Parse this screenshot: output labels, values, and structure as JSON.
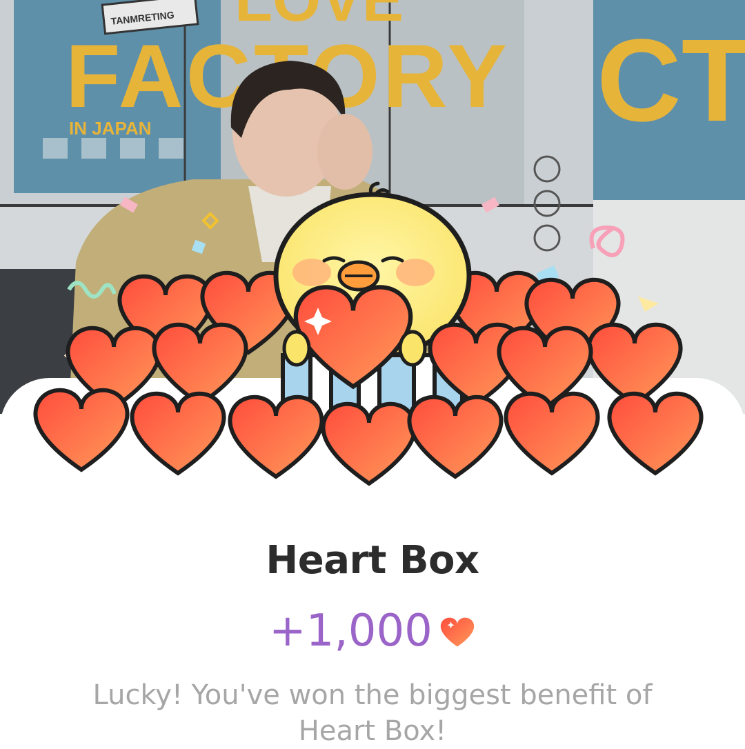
{
  "background": {
    "poster_line1": "LOVE",
    "poster_line2": "FACTORY",
    "poster_line3": "IN JAPAN",
    "poster_right": "CT",
    "sticker": "TANMRETING"
  },
  "popup": {
    "title": "Heart Box",
    "reward_amount": "+1,000",
    "reward_icon": "heart-icon",
    "message": "Lucky! You've won the biggest benefit of Heart Box!"
  },
  "colors": {
    "title": "#2c2c2c",
    "reward": "#9a64c8",
    "message": "#a6a6a6",
    "heart": "#ff6b4a"
  }
}
